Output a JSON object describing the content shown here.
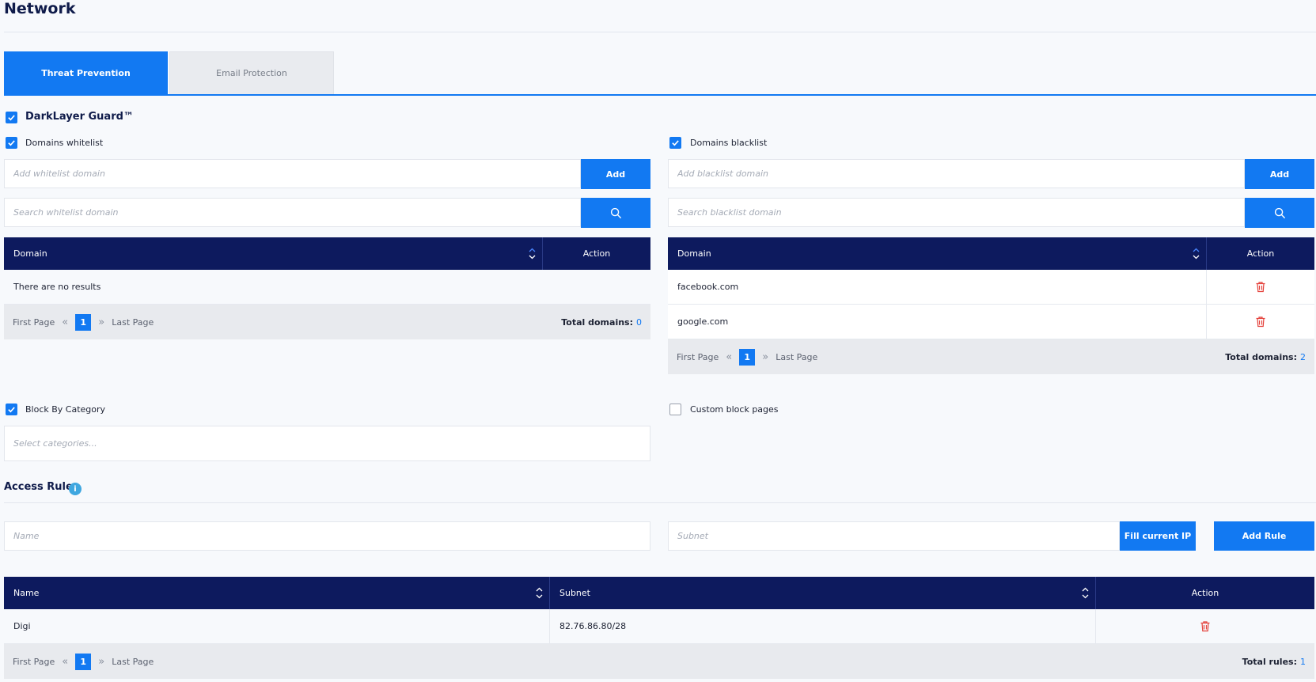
{
  "page": {
    "title": "Network"
  },
  "tabs": [
    {
      "label": "Threat Prevention",
      "active": true
    },
    {
      "label": "Email Protection",
      "active": false
    }
  ],
  "darklayer": {
    "label": "DarkLayer Guard™",
    "checked": true
  },
  "whitelist": {
    "label": "Domains whitelist",
    "checked": true,
    "add_placeholder": "Add whitelist domain",
    "add_button": "Add",
    "search_placeholder": "Search whitelist domain",
    "columns": [
      "Domain",
      "Action"
    ],
    "empty_text": "There are no results",
    "pager": {
      "first": "First Page",
      "page": "1",
      "last": "Last Page"
    },
    "total_label": "Total domains:",
    "total_value": "0"
  },
  "blacklist": {
    "label": "Domains blacklist",
    "checked": true,
    "add_placeholder": "Add blacklist domain",
    "add_button": "Add",
    "search_placeholder": "Search blacklist domain",
    "columns": [
      "Domain",
      "Action"
    ],
    "rows": [
      "facebook.com",
      "google.com"
    ],
    "pager": {
      "first": "First Page",
      "page": "1",
      "last": "Last Page"
    },
    "total_label": "Total domains:",
    "total_value": "2"
  },
  "category": {
    "label": "Block By Category",
    "checked": true,
    "placeholder": "Select categories..."
  },
  "custom_block": {
    "label": "Custom block pages",
    "checked": false
  },
  "access_rule": {
    "title": "Access Rule",
    "info_glyph": "i",
    "name_placeholder": "Name",
    "subnet_placeholder": "Subnet",
    "fill_button": "Fill current IP",
    "add_button": "Add Rule",
    "columns": [
      "Name",
      "Subnet",
      "Action"
    ],
    "rows": [
      {
        "name": "Digi",
        "subnet": "82.76.86.80/28"
      }
    ],
    "pager": {
      "first": "First Page",
      "page": "1",
      "last": "Last Page"
    },
    "total_label": "Total rules:",
    "total_value": "1"
  },
  "colors": {
    "accent": "#1279f2",
    "header_navy": "#0d1a5e",
    "danger": "#e4413b"
  }
}
